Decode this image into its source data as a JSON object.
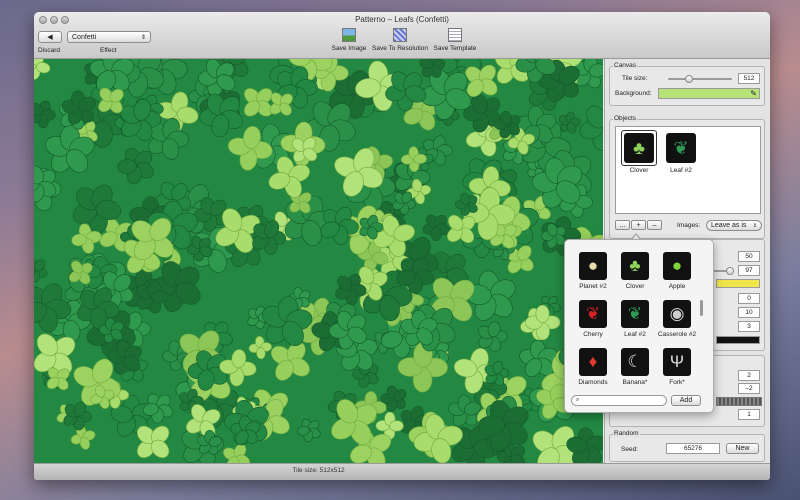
{
  "window": {
    "title": "Patterno – Leafs (Confetti)"
  },
  "toolbar": {
    "discard_label": "Discard",
    "effect_label": "Effect",
    "effect_value": "Confetti",
    "save_image_label": "Save Image",
    "save_resolution_label": "Save To Resolution",
    "save_template_label": "Save Template"
  },
  "status": {
    "text": "Tile size: 512x512"
  },
  "canvas_panel": {
    "title": "Canvas",
    "tile_size_label": "Tile size:",
    "tile_size_value": "512",
    "tile_size_level": 0.3,
    "background_label": "Background:",
    "background_color": "#b6e27a"
  },
  "objects_panel": {
    "title": "Objects",
    "items": [
      {
        "label": "Clover",
        "icon": "clover-icon",
        "selected": true
      },
      {
        "label": "Leaf #2",
        "icon": "leaf-icon",
        "selected": false
      }
    ],
    "more_label": "...",
    "add_label": "+",
    "remove_label": "–",
    "images_label": "Images:",
    "images_value": "Leave as is"
  },
  "settings_panel": {
    "values": [
      "50",
      "97",
      "0",
      "10",
      "3"
    ],
    "color_swatch": "#f0e64a",
    "line_swatch": "#111111"
  },
  "offset_panel": {
    "values": [
      "2",
      "–2",
      "1"
    ]
  },
  "random_panel": {
    "title": "Random",
    "seed_label": "Seed:",
    "seed_value": "65276",
    "new_label": "New"
  },
  "popover": {
    "items": [
      {
        "label": "Planet #2",
        "icon": "planet-icon"
      },
      {
        "label": "Clover",
        "icon": "clover-icon"
      },
      {
        "label": "Apple",
        "icon": "apple-icon"
      },
      {
        "label": "Cherry",
        "icon": "cherry-icon"
      },
      {
        "label": "Leaf #2",
        "icon": "leaf-icon"
      },
      {
        "label": "Casserole #2",
        "icon": "casserole-icon"
      },
      {
        "label": "Diamonds",
        "icon": "diamond-icon"
      },
      {
        "label": "Banana*",
        "icon": "banana-icon"
      },
      {
        "label": "Fork*",
        "icon": "fork-icon"
      }
    ],
    "search_placeholder": "",
    "add_label": "Add"
  }
}
